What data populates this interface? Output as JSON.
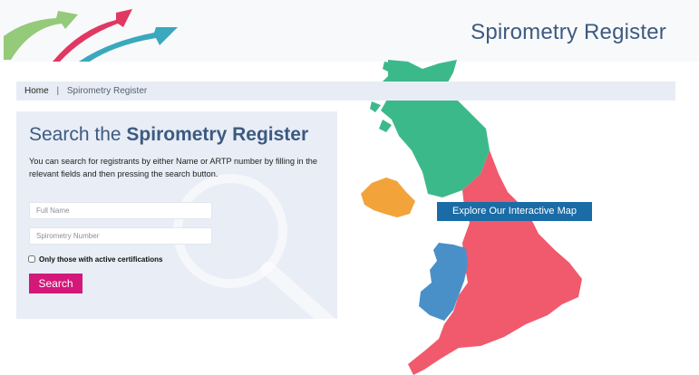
{
  "header": {
    "site_title": "Spirometry Register",
    "logo_colors": [
      "#88c46a",
      "#e02c5a",
      "#2fa3b9"
    ]
  },
  "breadcrumb": {
    "home": "Home",
    "separator": "|",
    "current": "Spirometry Register"
  },
  "search_panel": {
    "title_prefix": "Search the ",
    "title_emphasis": "Spirometry Register",
    "description": "You can search for registrants by either Name or ARTP number by filling in the relevant fields and then pressing the search button.",
    "full_name_placeholder": "Full Name",
    "full_name_value": "",
    "number_placeholder": "Spirometry Number",
    "number_value": "",
    "active_only_label": "Only those with active certifications",
    "active_only_checked": false,
    "search_button_label": "Search"
  },
  "map": {
    "explore_button_label": "Explore Our Interactive Map",
    "region_colors": {
      "scotland": "#3cb98a",
      "northern_ireland": "#f2a33a",
      "england": "#f05a6c",
      "wales": "#4a90c8"
    }
  }
}
